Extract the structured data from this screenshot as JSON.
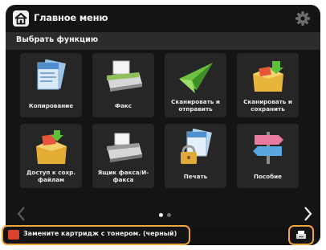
{
  "header": {
    "title": "Главное меню",
    "home_icon": "home-icon",
    "settings_icon": "gear-icon"
  },
  "subheader": {
    "label": "Выбрать функцию"
  },
  "tiles": [
    {
      "label": "Копирование",
      "icon": "copy-icon"
    },
    {
      "label": "Факс",
      "icon": "fax-icon"
    },
    {
      "label": "Сканировать и отправить",
      "icon": "scan-send-icon"
    },
    {
      "label": "Сканировать и сохранить",
      "icon": "scan-store-icon"
    },
    {
      "label": "Доступ к сохр. файлам",
      "icon": "stored-files-icon"
    },
    {
      "label": "Ящик факса/И-факса",
      "icon": "fax-inbox-icon"
    },
    {
      "label": "Печать",
      "icon": "secure-print-icon"
    },
    {
      "label": "Пособие",
      "icon": "tutorial-icon"
    }
  ],
  "pagination": {
    "pages": 2,
    "current": 1
  },
  "status": {
    "message": "Замените картридж с тонером. (черный)",
    "message_icon": "alert-icon",
    "monitor_icon": "status-monitor-icon"
  },
  "colors": {
    "background": "#141414",
    "tile": "#262626",
    "highlight": "#f0a63b",
    "alert": "#d9432e"
  }
}
